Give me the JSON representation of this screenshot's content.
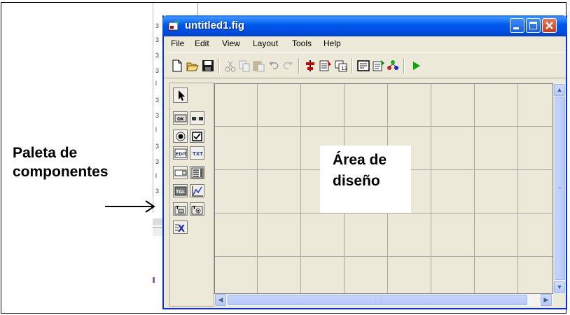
{
  "annotation": {
    "line1": "Paleta de",
    "line2": "componentes"
  },
  "window": {
    "title": "untitled1.fig",
    "title_bar_color": "#0054e3",
    "close_color": "#c33d1c"
  },
  "menu": [
    "File",
    "Edit",
    "View",
    "Layout",
    "Tools",
    "Help"
  ],
  "toolbar_icons": [
    "new-icon",
    "open-icon",
    "save-icon",
    "cut-icon",
    "copy-icon",
    "paste-icon",
    "undo-icon",
    "redo-icon",
    "align-icon",
    "menu-editor-icon",
    "tab-order-icon",
    "mfile-editor-icon",
    "property-inspector-icon",
    "object-browser-icon",
    "run-icon"
  ],
  "palette": {
    "items": [
      {
        "name": "select",
        "glyph": ""
      },
      {
        "name": "push-button",
        "glyph": "OK"
      },
      {
        "name": "slider",
        "glyph": ""
      },
      {
        "name": "radio-button",
        "glyph": ""
      },
      {
        "name": "checkbox",
        "glyph": ""
      },
      {
        "name": "edit-text",
        "glyph": "EDIT"
      },
      {
        "name": "static-text",
        "glyph": "TXT"
      },
      {
        "name": "popup-menu",
        "glyph": ""
      },
      {
        "name": "listbox",
        "glyph": ""
      },
      {
        "name": "toggle-button",
        "glyph": "TGL"
      },
      {
        "name": "axes",
        "glyph": ""
      },
      {
        "name": "panel",
        "glyph": "T"
      },
      {
        "name": "button-group",
        "glyph": "T"
      },
      {
        "name": "activex",
        "glyph": "X"
      }
    ]
  },
  "design_area": {
    "line1": "Área de",
    "line2": "diseño"
  }
}
